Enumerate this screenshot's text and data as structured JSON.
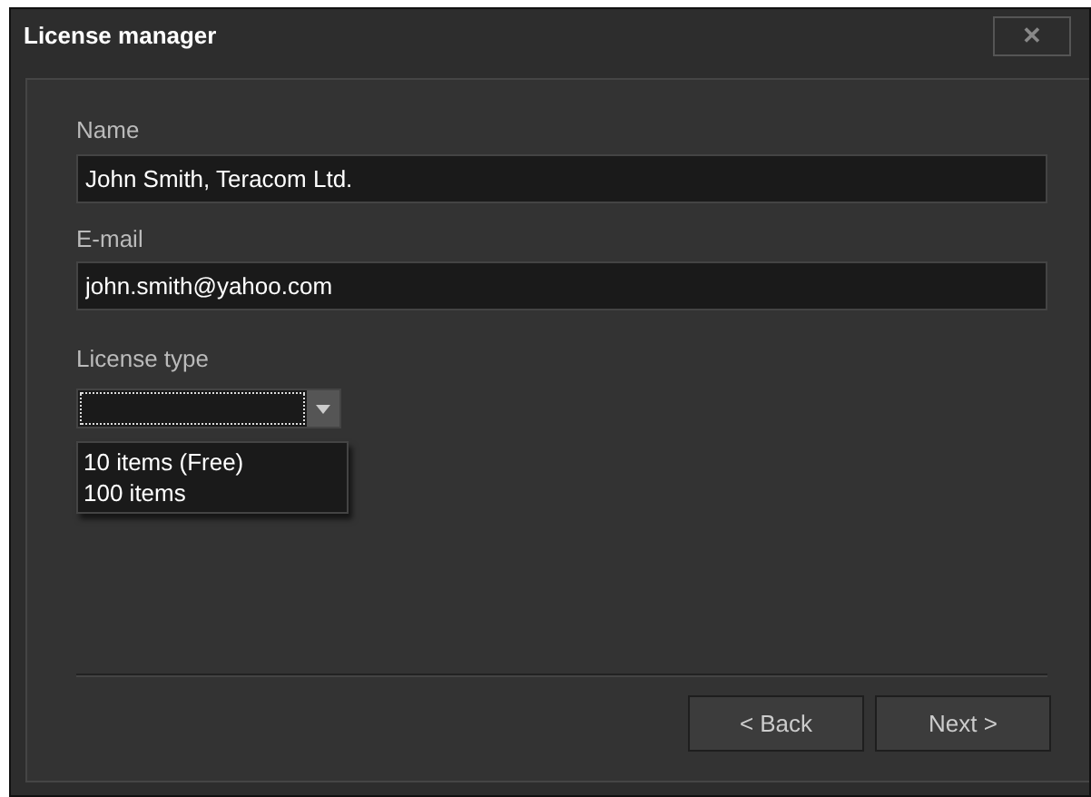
{
  "window": {
    "title": "License manager",
    "close": "✕"
  },
  "fields": [
    {
      "label": "Name",
      "value": "John Smith, Teracom Ltd."
    },
    {
      "label": "E-mail",
      "value": "john.smith@yahoo.com"
    }
  ],
  "license_type": {
    "label": "License type",
    "options": [
      "10 items (Free)",
      "100 items"
    ]
  },
  "buttons": [
    "< Back",
    "Next >"
  ]
}
